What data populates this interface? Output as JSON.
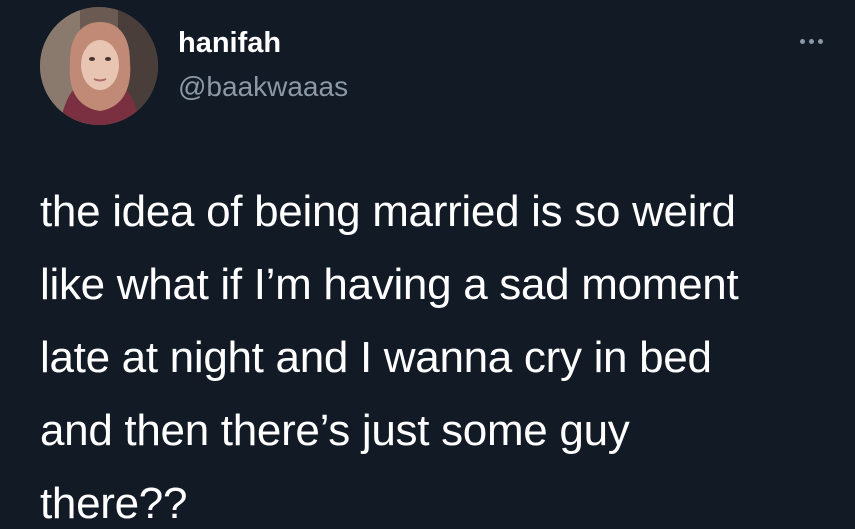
{
  "tweet": {
    "author": {
      "display_name": "hanifah",
      "handle": "@baakwaaas",
      "avatar_icon": "profile-photo"
    },
    "more_icon": "more-horizontal-icon",
    "text_lines": [
      "the idea of being married is so weird",
      "like what if I’m having a sad moment",
      "late at night and I wanna cry in bed",
      "and then there’s just some guy",
      "there??"
    ]
  },
  "colors": {
    "background": "#121a26",
    "text": "#ffffff",
    "secondary_text": "#8b98a5"
  }
}
